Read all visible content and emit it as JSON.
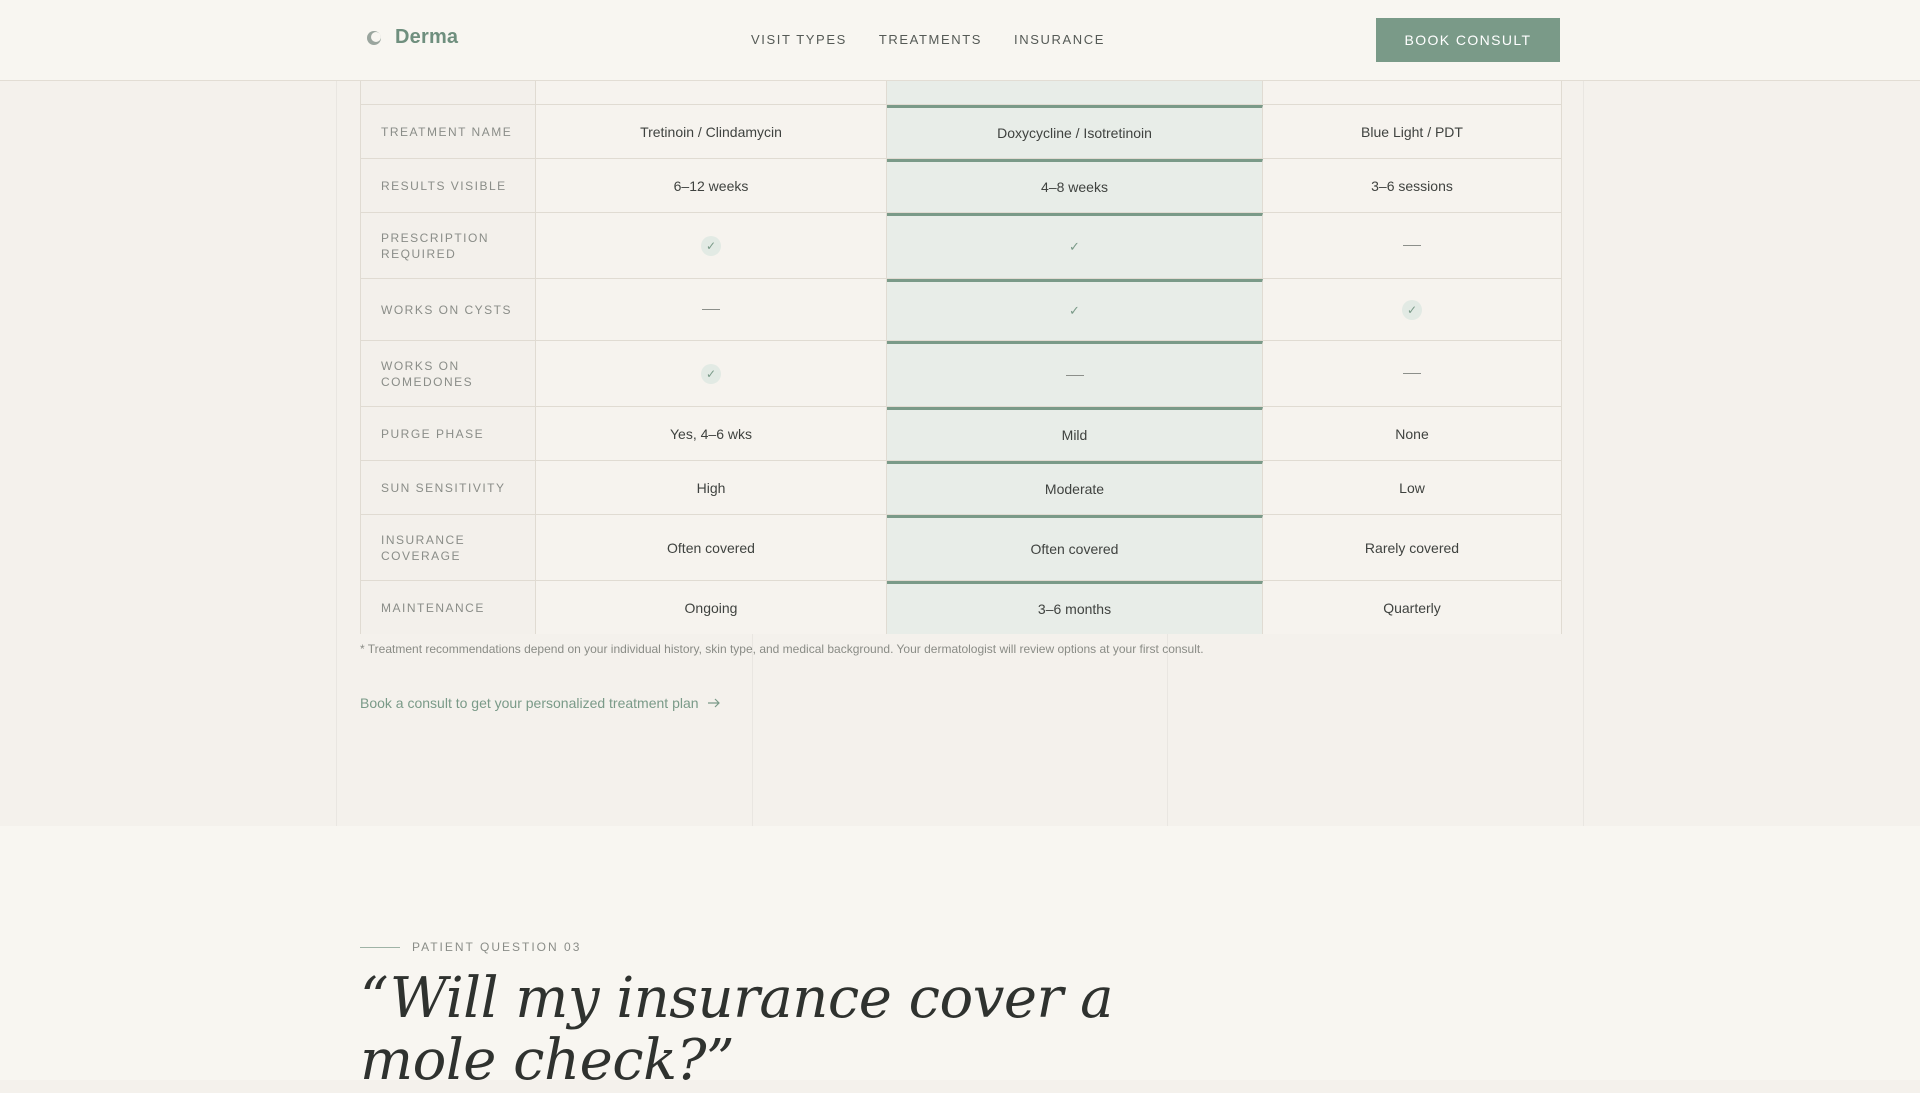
{
  "header": {
    "logo_text": "Derma",
    "nav": [
      "VISIT TYPES",
      "TREATMENTS",
      "INSURANCE"
    ],
    "cta_label": "BOOK CONSULT"
  },
  "table": {
    "rows": [
      {
        "label": "TREATMENT NAME",
        "cells": [
          {
            "type": "text",
            "value": "Tretinoin / Clindamycin"
          },
          {
            "type": "text",
            "value": "Doxycycline / Isotretinoin"
          },
          {
            "type": "text",
            "value": "Blue Light / PDT"
          }
        ]
      },
      {
        "label": "RESULTS VISIBLE",
        "cells": [
          {
            "type": "text",
            "value": "6–12 weeks"
          },
          {
            "type": "text",
            "value": "4–8 weeks"
          },
          {
            "type": "text",
            "value": "3–6 sessions"
          }
        ]
      },
      {
        "label": "PRESCRIPTION REQUIRED",
        "cells": [
          {
            "type": "check"
          },
          {
            "type": "check"
          },
          {
            "type": "dash"
          }
        ]
      },
      {
        "label": "WORKS ON CYSTS",
        "cells": [
          {
            "type": "dash"
          },
          {
            "type": "check"
          },
          {
            "type": "check"
          }
        ]
      },
      {
        "label": "WORKS ON COMEDONES",
        "cells": [
          {
            "type": "check"
          },
          {
            "type": "dash"
          },
          {
            "type": "dash"
          }
        ]
      },
      {
        "label": "PURGE PHASE",
        "cells": [
          {
            "type": "text",
            "value": "Yes, 4–6 wks"
          },
          {
            "type": "text",
            "value": "Mild"
          },
          {
            "type": "text",
            "value": "None"
          }
        ]
      },
      {
        "label": "SUN SENSITIVITY",
        "cells": [
          {
            "type": "text",
            "value": "High"
          },
          {
            "type": "text",
            "value": "Moderate"
          },
          {
            "type": "text",
            "value": "Low"
          }
        ]
      },
      {
        "label": "INSURANCE COVERAGE",
        "cells": [
          {
            "type": "text",
            "value": "Often covered"
          },
          {
            "type": "text",
            "value": "Often covered"
          },
          {
            "type": "text",
            "value": "Rarely covered"
          }
        ]
      },
      {
        "label": "MAINTENANCE",
        "cells": [
          {
            "type": "text",
            "value": "Ongoing"
          },
          {
            "type": "text",
            "value": "3–6 months"
          },
          {
            "type": "text",
            "value": "Quarterly"
          }
        ]
      }
    ]
  },
  "footnote": "* Treatment recommendations depend on your individual history, skin type, and medical background. Your dermatologist will review options at your first consult.",
  "consult_link": "Book a consult to get your personalized treatment plan",
  "question": {
    "eyebrow": "PATIENT QUESTION 03",
    "title": "“Will my insurance cover a mole check?”"
  },
  "colors": {
    "accent": "#7a9a88",
    "highlight_column": "#e8ede8",
    "background": "#f4f1ec"
  },
  "icons": [
    "logo-mark-icon",
    "check-icon",
    "dash-icon",
    "arrow-right-icon"
  ]
}
